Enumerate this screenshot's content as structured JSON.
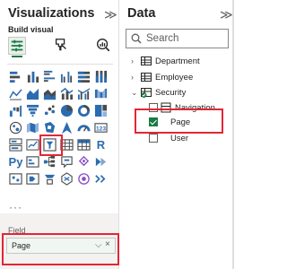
{
  "visualizations": {
    "title": "Visualizations",
    "collapse_glyph": "≫",
    "build_visual_label": "Build visual",
    "tools": [
      {
        "icon": "build-visual-icon",
        "active": true
      },
      {
        "icon": "format-paintbrush-icon",
        "active": false
      },
      {
        "icon": "analytics-magnifier-icon",
        "active": false
      }
    ],
    "gallery_rows": [
      [
        "stacked-bar-icon",
        "stacked-column-icon",
        "clustered-bar-icon",
        "clustered-column-icon",
        "100-stacked-bar-icon",
        "100-stacked-column-icon"
      ],
      [
        "line-chart-icon",
        "area-chart-icon",
        "stacked-area-icon",
        "line-stacked-column-icon",
        "line-clustered-column-icon",
        "ribbon-chart-icon"
      ],
      [
        "waterfall-icon",
        "funnel-icon",
        "scatter-icon",
        "pie-chart-icon",
        "donut-chart-icon",
        "treemap-icon"
      ],
      [
        "map-icon",
        "filled-map-icon",
        "shape-map-icon",
        "azure-map-icon",
        "gauge-icon",
        "card-icon"
      ],
      [
        "multi-row-card-icon",
        "kpi-icon",
        "slicer-icon",
        "table-icon",
        "matrix-icon",
        "r-visual-icon"
      ],
      [
        "python-visual-icon",
        "key-influencers-icon",
        "decomposition-tree-icon",
        "qa-icon",
        "smart-narrative-icon",
        "paginated-report-icon"
      ],
      [
        "power-apps-icon",
        "power-automate-icon",
        "metrics-icon",
        "custom-visual-icon",
        "arcgis-icon",
        "more-visuals-icon"
      ]
    ],
    "more_label": "···",
    "field_label": "Field",
    "field_value": "Page",
    "field_chevron": "⌵",
    "field_remove": "×"
  },
  "data": {
    "title": "Data",
    "collapse_glyph": "≫",
    "search_placeholder": "Search",
    "tables": [
      {
        "label": "Department",
        "expanded": false
      },
      {
        "label": "Employee",
        "expanded": false
      },
      {
        "label": "Security",
        "expanded": true
      }
    ],
    "security_fields": [
      {
        "label": "Navigation",
        "kind": "table-field"
      },
      {
        "label": "Page",
        "checked": true
      },
      {
        "label": "User",
        "checked": false
      }
    ],
    "expand_glyph": "›",
    "expanded_glyph": "⌄"
  },
  "colors": {
    "accent_green": "#1a7a45",
    "highlight_red": "#e32636",
    "field_bg": "#f3f2f1"
  }
}
